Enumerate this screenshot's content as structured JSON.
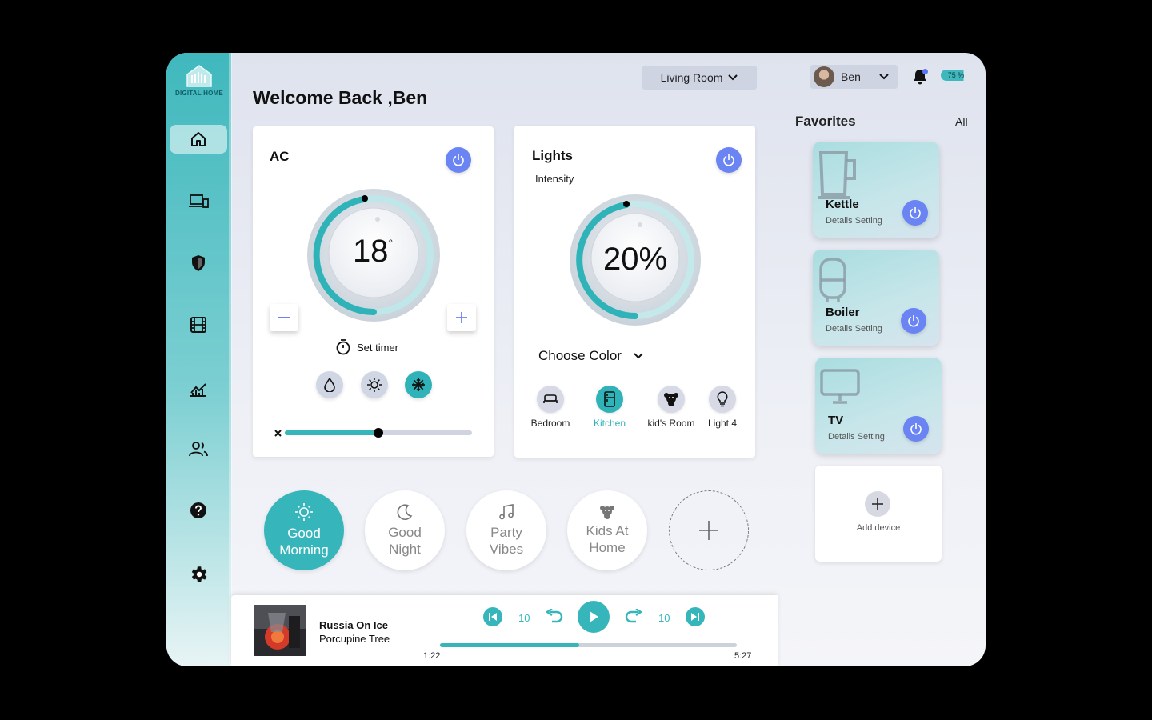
{
  "brand": {
    "name": "DIGITAL HOME"
  },
  "header": {
    "welcome": "Welcome Back ,Ben",
    "room_select": "Living Room"
  },
  "sidebar": {
    "items": [
      {
        "name": "home",
        "icon": "home-icon",
        "active": true
      },
      {
        "name": "devices",
        "icon": "devices-icon",
        "active": false
      },
      {
        "name": "security",
        "icon": "shield-icon",
        "active": false
      },
      {
        "name": "media",
        "icon": "film-icon",
        "active": false
      },
      {
        "name": "analytics",
        "icon": "chart-icon",
        "active": false
      },
      {
        "name": "users",
        "icon": "users-icon",
        "active": false
      },
      {
        "name": "help",
        "icon": "help-icon",
        "active": false
      },
      {
        "name": "settings",
        "icon": "gear-icon",
        "active": false
      }
    ]
  },
  "ac": {
    "title": "AC",
    "temperature": "18",
    "degree_symbol": "°",
    "set_timer": "Set timer",
    "modes": [
      "humidity",
      "sun",
      "snowflake"
    ],
    "active_mode": "snowflake",
    "fan_level": 0.5
  },
  "lights": {
    "title": "Lights",
    "intensity_label": "Intensity",
    "intensity": "20%",
    "choose_color": "Choose Color",
    "rooms": [
      {
        "label": "Bedroom",
        "icon": "bed-icon",
        "active": false
      },
      {
        "label": "Kitchen",
        "icon": "fridge-icon",
        "active": true
      },
      {
        "label": "kid's Room",
        "icon": "teddy-icon",
        "active": false
      },
      {
        "label": "Light 4",
        "icon": "bulb-icon",
        "active": false
      }
    ]
  },
  "scenes": [
    {
      "line1": "Good",
      "line2": "Morning",
      "icon": "sun-icon",
      "active": true
    },
    {
      "line1": "Good",
      "line2": "Night",
      "icon": "moon-icon",
      "active": false
    },
    {
      "line1": "Party",
      "line2": "Vibes",
      "icon": "music-icon",
      "active": false
    },
    {
      "line1": "Kids At",
      "line2": "Home",
      "icon": "teddy-icon",
      "active": false
    }
  ],
  "player": {
    "title": "Russia On Ice",
    "artist": "Porcupine Tree",
    "skip_back": "10",
    "skip_forward": "10",
    "elapsed": "1:22",
    "duration": "5:27",
    "progress": 0.47
  },
  "user": {
    "name": "Ben",
    "battery": "75 %"
  },
  "favorites": {
    "title": "Favorites",
    "all_label": "All",
    "items": [
      {
        "name": "Kettle",
        "sub": "Details Setting",
        "icon": "kettle-icon"
      },
      {
        "name": "Boiler",
        "sub": "Details Setting",
        "icon": "boiler-icon"
      },
      {
        "name": "TV",
        "sub": "Details Setting",
        "icon": "tv-icon"
      }
    ],
    "add_label": "Add device"
  },
  "colors": {
    "accent": "#36b6bb",
    "power": "#6b84f3"
  }
}
